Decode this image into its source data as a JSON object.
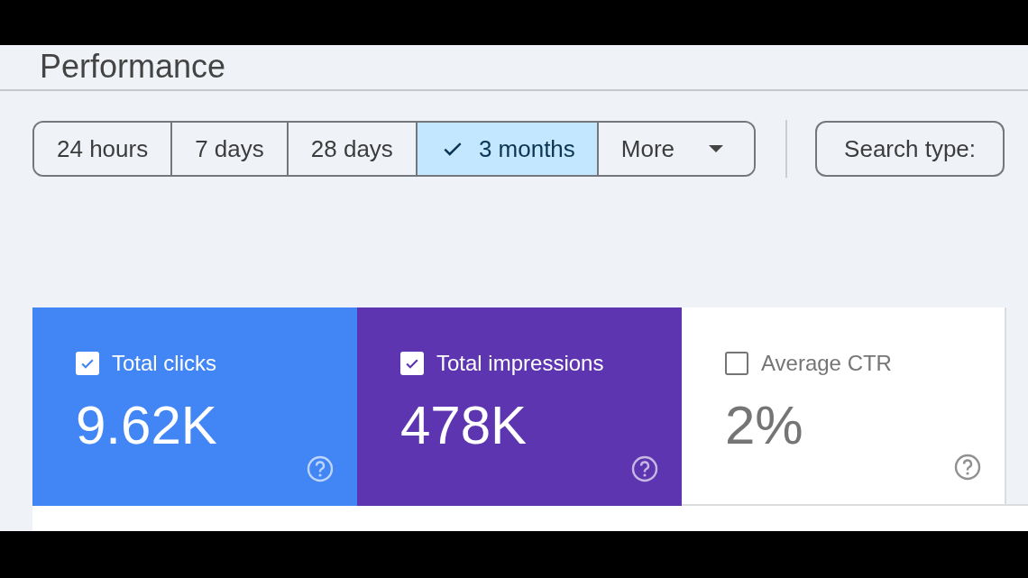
{
  "page": {
    "title": "Performance"
  },
  "date_range": [
    {
      "label": "24 hours",
      "selected": false
    },
    {
      "label": "7 days",
      "selected": false
    },
    {
      "label": "28 days",
      "selected": false
    },
    {
      "label": "3 months",
      "selected": true
    }
  ],
  "more_button": {
    "label": "More"
  },
  "search_type_button": {
    "label": "Search type:"
  },
  "metrics": [
    {
      "label": "Total clicks",
      "value": "9.62K",
      "checked": true,
      "color": "#4285f4"
    },
    {
      "label": "Total impressions",
      "value": "478K",
      "checked": true,
      "color": "#5e35b1"
    },
    {
      "label": "Average CTR",
      "value": "2%",
      "checked": false,
      "color": "#ffffff"
    }
  ]
}
